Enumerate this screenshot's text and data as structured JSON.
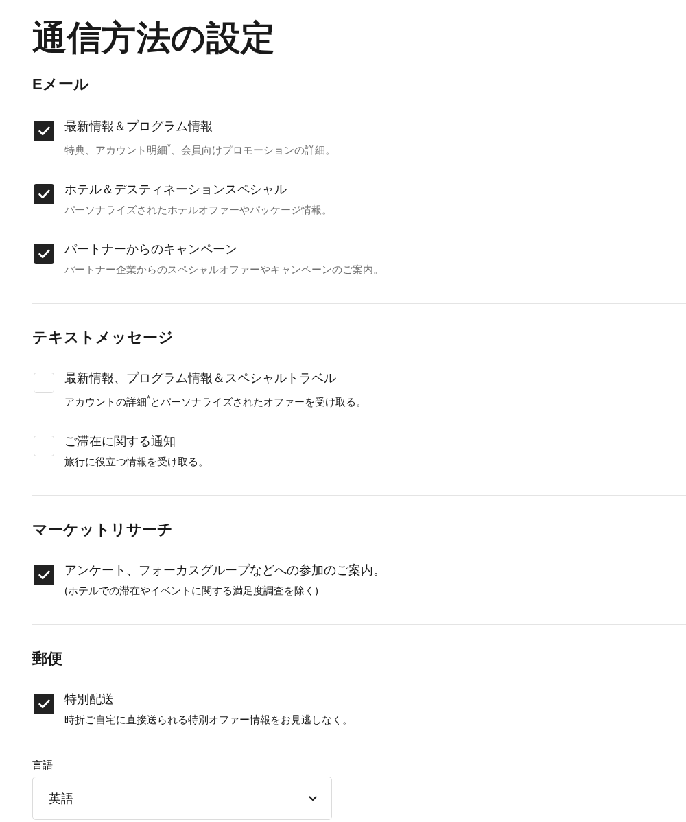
{
  "title": "通信方法の設定",
  "sections": [
    {
      "heading": "Eメール",
      "items": [
        {
          "label": "最新情報＆プログラム情報",
          "description": "特典、アカウント明細$^{*}$、会員向けプロモーションの詳細。",
          "checked": true,
          "muted": true
        },
        {
          "label": "ホテル＆デスティネーションスペシャル",
          "description": "パーソナライズされたホテルオファーやパッケージ情報。",
          "checked": true,
          "muted": true
        },
        {
          "label": "パートナーからのキャンペーン",
          "description": "パートナー企業からのスペシャルオファーやキャンペーンのご案内。",
          "checked": true,
          "muted": true
        }
      ]
    },
    {
      "heading": "テキストメッセージ",
      "items": [
        {
          "label": "最新情報、プログラム情報＆スペシャルトラベル",
          "description": "アカウントの詳細$^{*}$とパーソナライズされたオファーを受け取る。",
          "checked": false,
          "muted": false
        },
        {
          "label": "ご滞在に関する通知",
          "description": "旅行に役立つ情報を受け取る。",
          "checked": false,
          "muted": false
        }
      ]
    },
    {
      "heading": "マーケットリサーチ",
      "items": [
        {
          "label": "アンケート、フォーカスグループなどへの参加のご案内。",
          "description": "(ホテルでの滞在やイベントに関する満足度調査を除く)",
          "checked": true,
          "muted": false
        }
      ]
    },
    {
      "heading": "郵便",
      "items": [
        {
          "label": "特別配送",
          "description": "時折ご自宅に直接送られる特別オファー情報をお見逃しなく。",
          "checked": true,
          "muted": false
        }
      ]
    }
  ],
  "language": {
    "label": "言語",
    "value": "英語"
  }
}
